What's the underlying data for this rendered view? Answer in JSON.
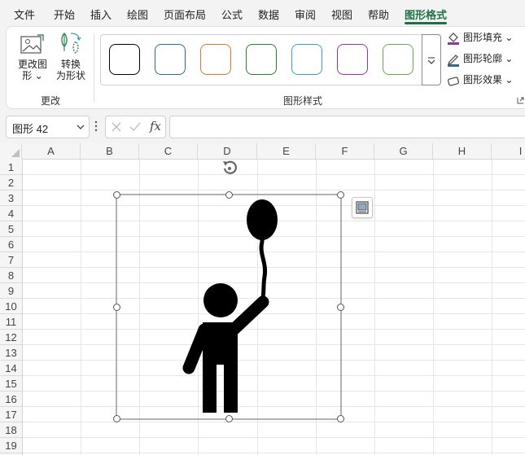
{
  "menu": {
    "items": [
      {
        "label": "文件"
      },
      {
        "label": "开始"
      },
      {
        "label": "插入"
      },
      {
        "label": "绘图"
      },
      {
        "label": "页面布局"
      },
      {
        "label": "公式"
      },
      {
        "label": "数据"
      },
      {
        "label": "审阅"
      },
      {
        "label": "视图"
      },
      {
        "label": "帮助"
      },
      {
        "label": "图形格式"
      }
    ]
  },
  "ribbon": {
    "change_shape_label_1": "更改图",
    "change_shape_label_2": "形",
    "convert_label_1": "转换",
    "convert_label_2": "为形状",
    "group_change": "更改",
    "group_styles": "图形样式",
    "fill_label": "图形填充",
    "outline_label": "图形轮廓",
    "effects_label": "图形效果",
    "swatch_colors": [
      "#000000",
      "#2f6b8f",
      "#d9782d",
      "#2e7d32",
      "#3a9fc0",
      "#8e3a9d",
      "#6aa84f"
    ]
  },
  "formula_bar": {
    "name_box": "图形 42",
    "formula_value": "",
    "fx": "fx"
  },
  "sheet": {
    "columns": [
      "A",
      "B",
      "C",
      "D",
      "E",
      "F",
      "G",
      "H",
      "I"
    ],
    "rows": [
      "1",
      "2",
      "3",
      "4",
      "5",
      "6",
      "7",
      "8",
      "9",
      "10",
      "11",
      "12",
      "13",
      "14",
      "15",
      "16",
      "17",
      "18",
      "19"
    ]
  },
  "colors": {
    "accent": "#1e7145",
    "fill_bar": "#8e3a9d",
    "outline_bar": "#2f6b8f"
  }
}
